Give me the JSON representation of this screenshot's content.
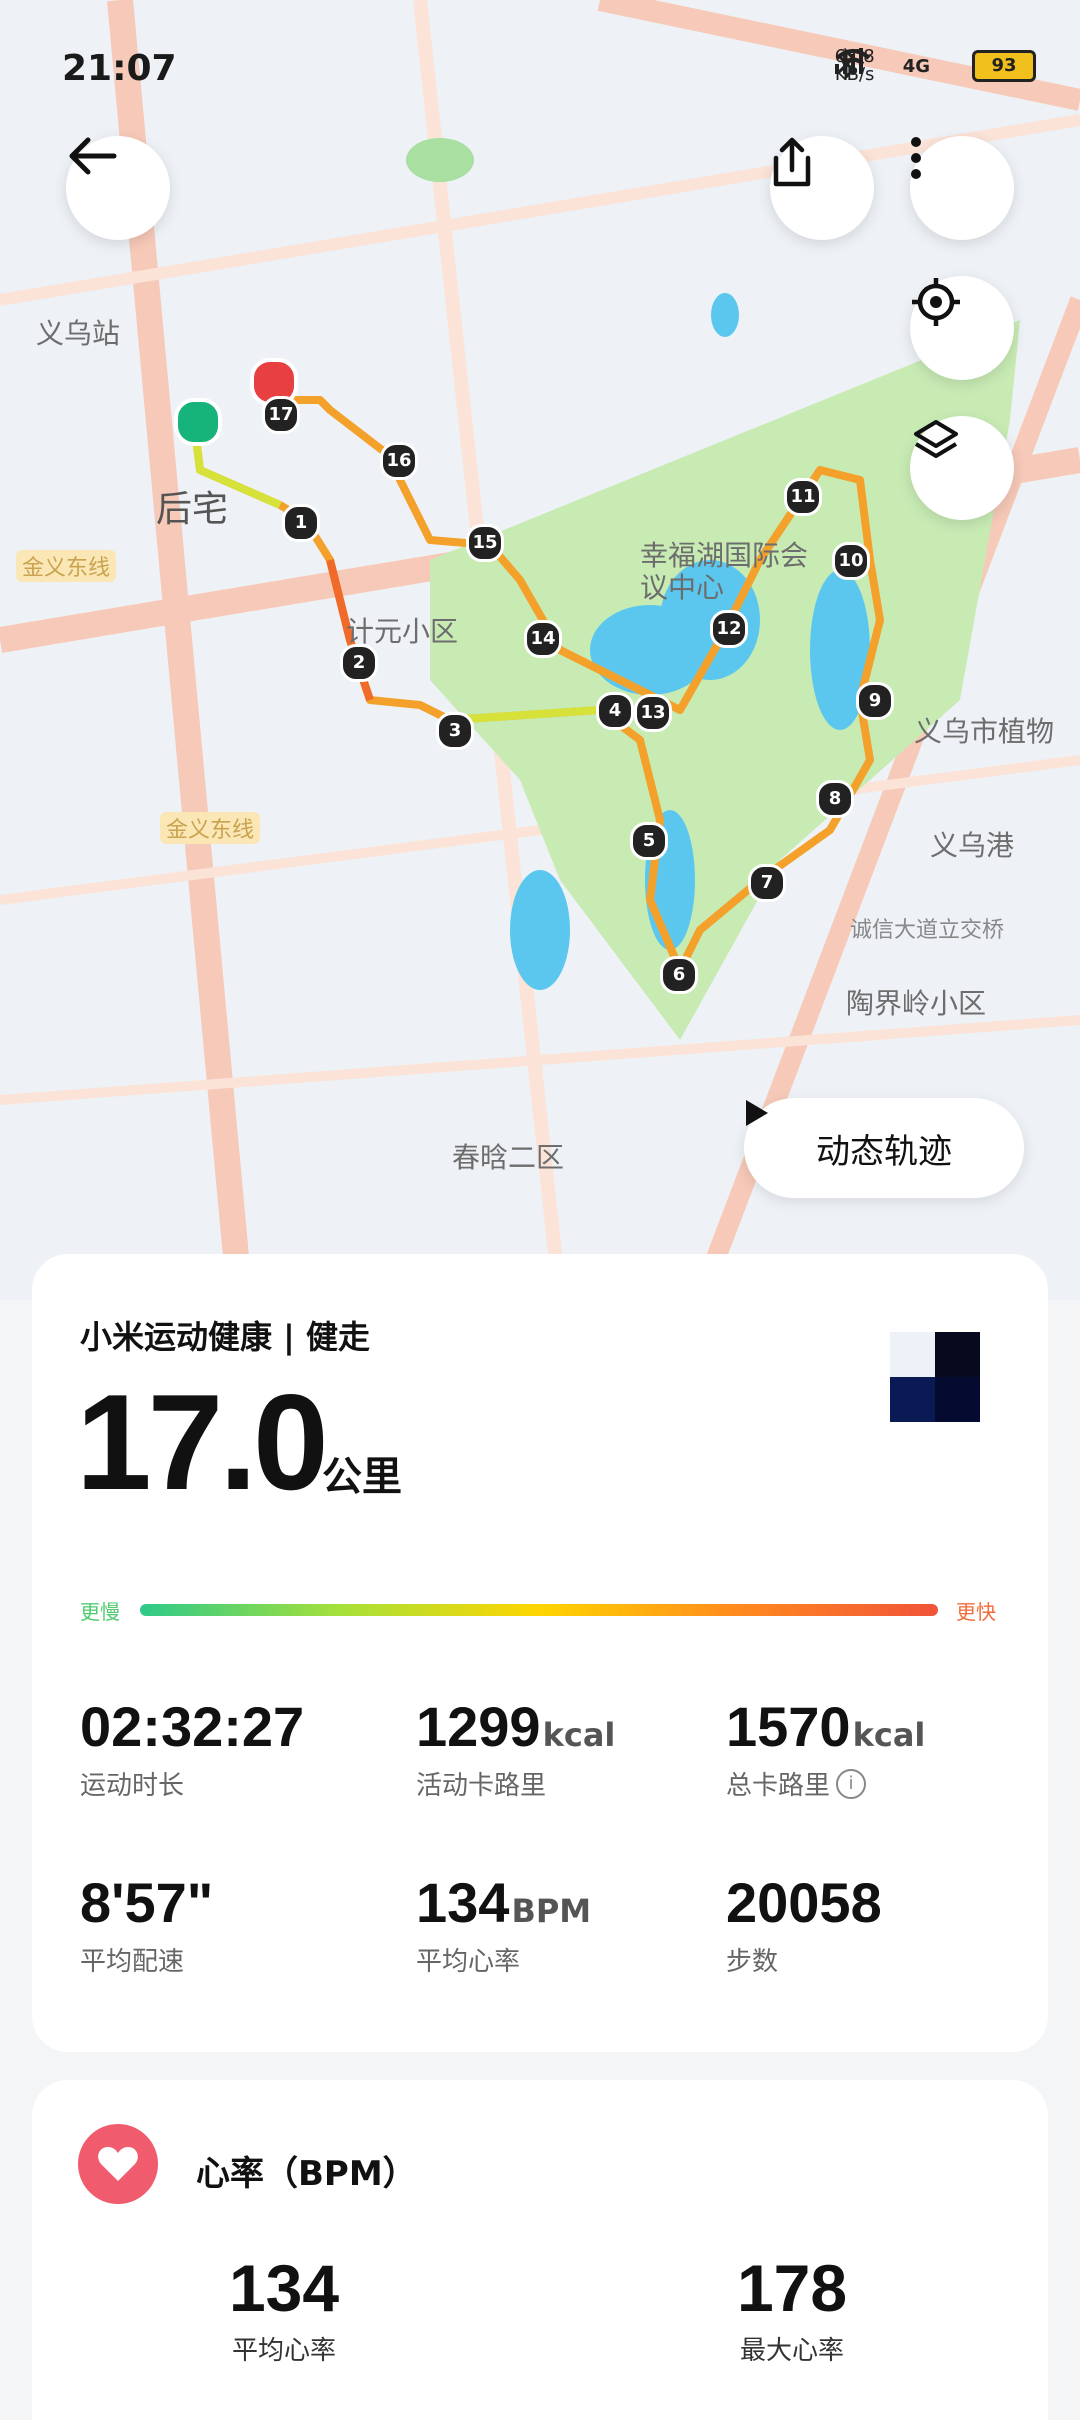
{
  "status": {
    "time": "21:07",
    "net_speed": "6.08",
    "net_unit": "KB/s",
    "signal": "4G",
    "battery": "93"
  },
  "map": {
    "labels": {
      "yiwu_station": "义乌站",
      "houzhai": "后宅",
      "jinyi_east1": "金义东线",
      "jinyi_east2": "金义东线",
      "jiyuan": "计元小区",
      "conference": "幸福湖国际会议中心",
      "yiwu_botanic": "义乌市植物",
      "yiwu_port": "义乌港",
      "chengxin": "诚信大道立交桥",
      "taojieling": "陶界岭小区",
      "chunhan": "春晗二区"
    },
    "markers": [
      "1",
      "2",
      "3",
      "4",
      "5",
      "6",
      "7",
      "8",
      "9",
      "10",
      "11",
      "12",
      "13",
      "14",
      "15",
      "16",
      "17"
    ]
  },
  "buttons": {
    "back": "back",
    "share": "share",
    "more": "more",
    "locate": "locate",
    "layers": "layers",
    "dynamic_track": "动态轨迹"
  },
  "summary": {
    "brand": "小米运动健康 | 健走",
    "distance": "17.0",
    "distance_unit": "公里",
    "pace_slow": "更慢",
    "pace_fast": "更快",
    "stats": [
      {
        "value": "02:32:27",
        "unit": "",
        "label": "运动时长"
      },
      {
        "value": "1299",
        "unit": "kcal",
        "label": "活动卡路里"
      },
      {
        "value": "1570",
        "unit": "kcal",
        "label": "总卡路里"
      },
      {
        "value": "8'57\"",
        "unit": "",
        "label": "平均配速"
      },
      {
        "value": "134",
        "unit": "BPM",
        "label": "平均心率"
      },
      {
        "value": "20058",
        "unit": "",
        "label": "步数"
      }
    ]
  },
  "heart_rate": {
    "title": "心率（BPM）",
    "avg_value": "134",
    "avg_label": "平均心率",
    "max_value": "178",
    "max_label": "最大心率"
  }
}
